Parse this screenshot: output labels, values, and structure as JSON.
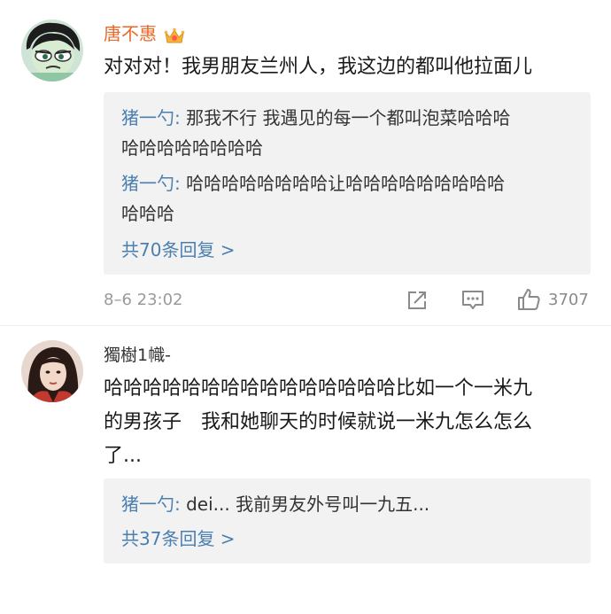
{
  "comments": [
    {
      "username": "唐不惠",
      "username_color": "#e8692a",
      "badge_icon": "vip-crown-icon",
      "text": "对对对！我男朋友兰州人，我这边的都叫他拉面儿",
      "replies": [
        {
          "name": "猪一勺",
          "sep": ": ",
          "text_l1": "那我不行 我遇见的每一个都叫泡菜哈哈哈",
          "text_l2": "哈哈哈哈哈哈哈哈"
        },
        {
          "name": "猪一勺",
          "sep": ": ",
          "text_l1": "哈哈哈哈哈哈哈哈让哈哈哈哈哈哈哈哈哈",
          "text_l2": "哈哈哈"
        }
      ],
      "more_replies": "共70条回复 >",
      "time": "8–6 23:02",
      "likes": "3707",
      "actions": [
        "share-icon",
        "comment-icon",
        "like-icon"
      ]
    },
    {
      "username": "獨樹1幟-",
      "username_color": "#333333",
      "text_l1": "哈哈哈哈哈哈哈哈哈哈哈哈哈哈哈比如一个一米九",
      "text_l2": "的男孩子　我和她聊天的时候就说一米九怎么怎么",
      "text_l3": "了...",
      "replies": [
        {
          "name": "猪一勺",
          "sep": ": ",
          "text_l1": "dei... 我前男友外号叫一九五..."
        }
      ],
      "more_replies": "共37条回复 >"
    }
  ]
}
